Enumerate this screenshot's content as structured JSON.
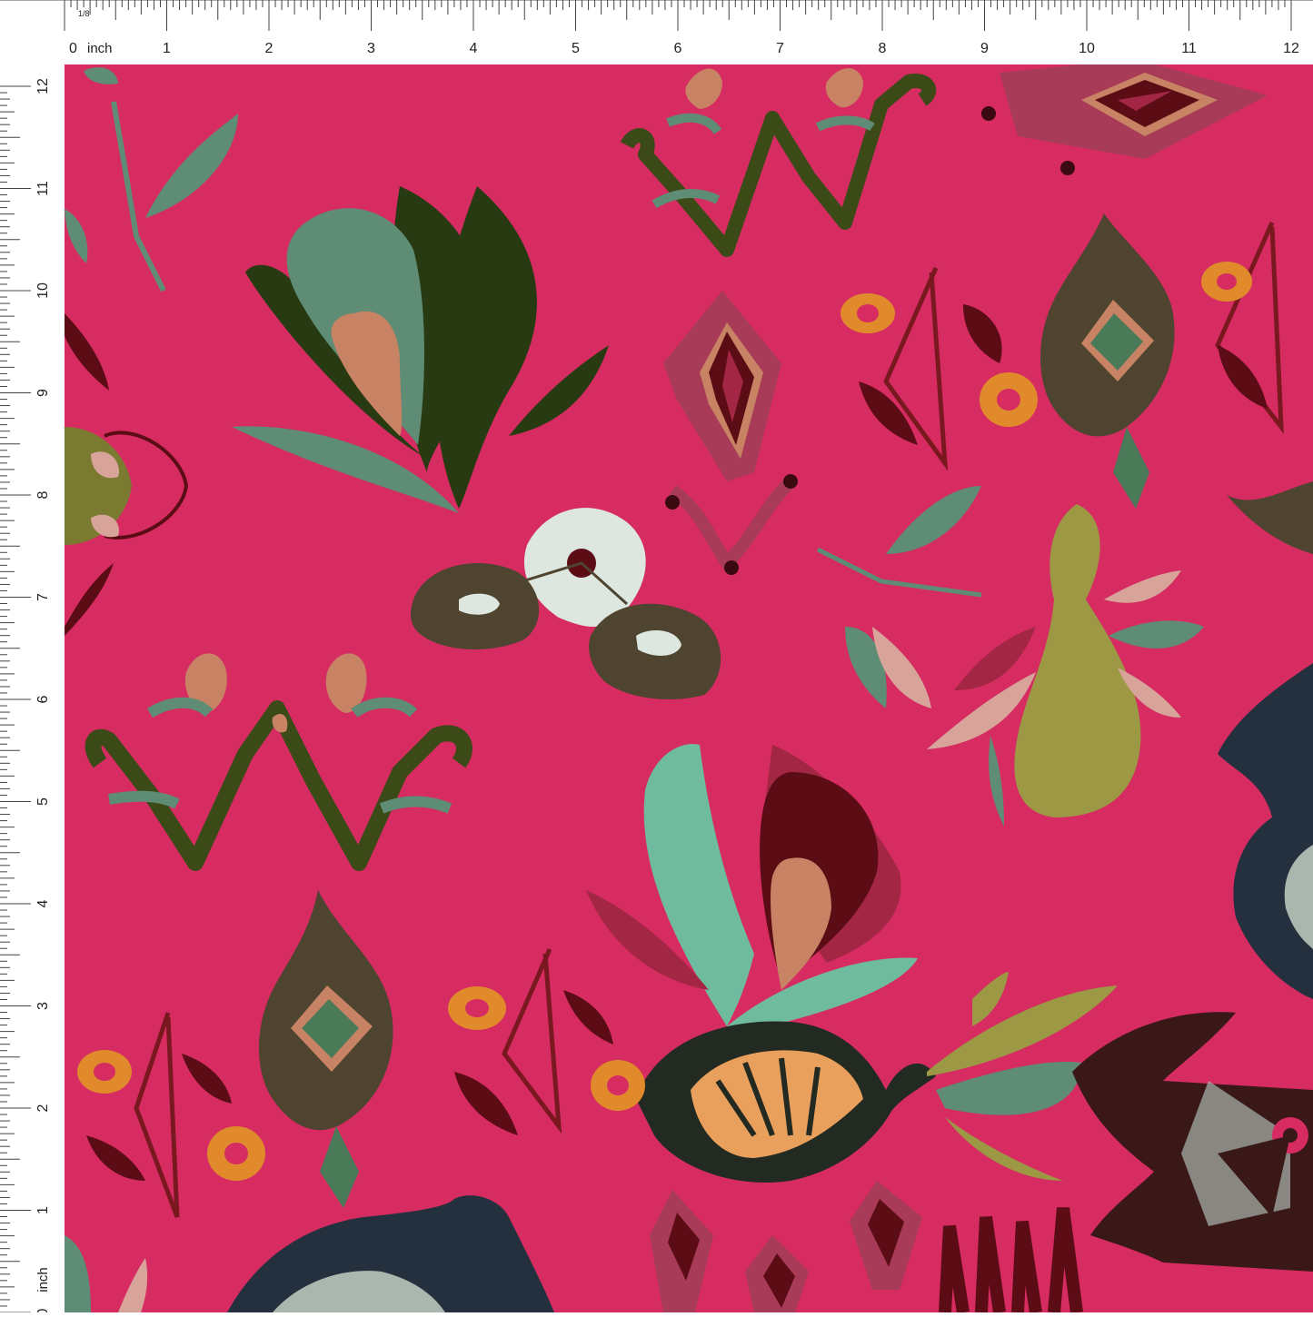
{
  "ruler": {
    "unit_label": "inch",
    "top_numbers": [
      "0",
      "1",
      "2",
      "3",
      "4",
      "5",
      "6",
      "7",
      "8",
      "9",
      "10",
      "11",
      "12"
    ],
    "left_numbers": [
      "0",
      "1",
      "2",
      "3",
      "4",
      "5",
      "6",
      "7",
      "8",
      "9",
      "10",
      "11",
      "12"
    ],
    "fraction_mark": "1/8"
  },
  "fabric": {
    "background_color": "#d62c62",
    "motifs": [
      "botanical-tulip-dark-green",
      "botanical-tulip-teal",
      "zigzag-vine-olive",
      "ikat-diamond-medallion",
      "floral-orange-buds",
      "pear-fruit",
      "ikat-navy-swirl",
      "eye-spot-trio",
      "scalloped-flower-orange"
    ]
  },
  "colors": {
    "pink": "#d62c62",
    "dark_green": "#273a12",
    "sage": "#5e8c74",
    "teal": "#6fbba0",
    "olive": "#3c4a18",
    "salmon": "#c88264",
    "maroon": "#5c0c14",
    "mustard": "#9c9844",
    "orange": "#e08a2c",
    "navy": "#25303f",
    "brown": "#4e4430",
    "grey": "#aab6ae"
  }
}
